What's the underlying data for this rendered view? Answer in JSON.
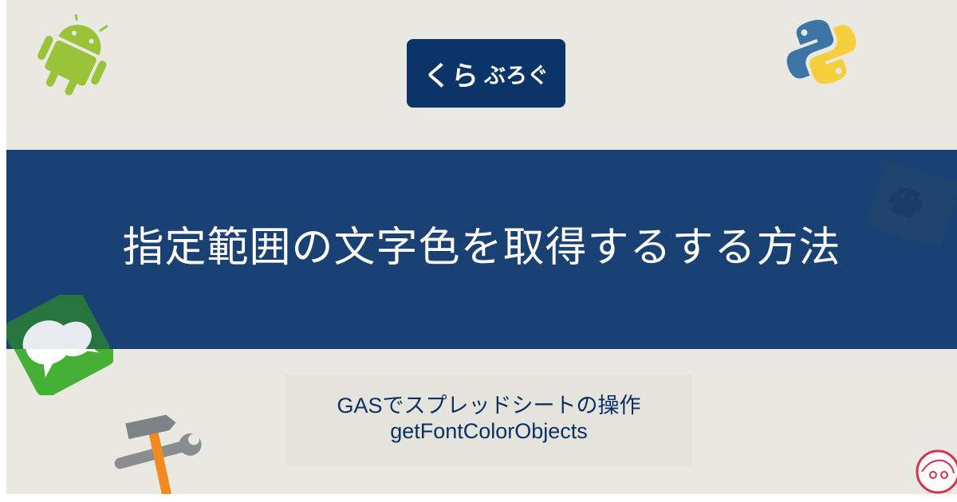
{
  "logo": {
    "main": "くら",
    "sub": "ぶろぐ"
  },
  "title": "指定範囲の文字色を取得するする方法",
  "subtitle": {
    "line1": "GASでスプレッドシートの操作",
    "line2": "getFontColorObjects"
  },
  "icons": {
    "android": "android-icon",
    "python": "python-icon",
    "chat": "chat-icon",
    "tools": "hammer-wrench-icon",
    "robot": "robot-icon",
    "avatar": "avatar-icon"
  },
  "colors": {
    "background": "#e9e8e1",
    "banner": "#1a4174",
    "logo_box": "#0b3469",
    "subtitle_text": "#0c2f66"
  }
}
